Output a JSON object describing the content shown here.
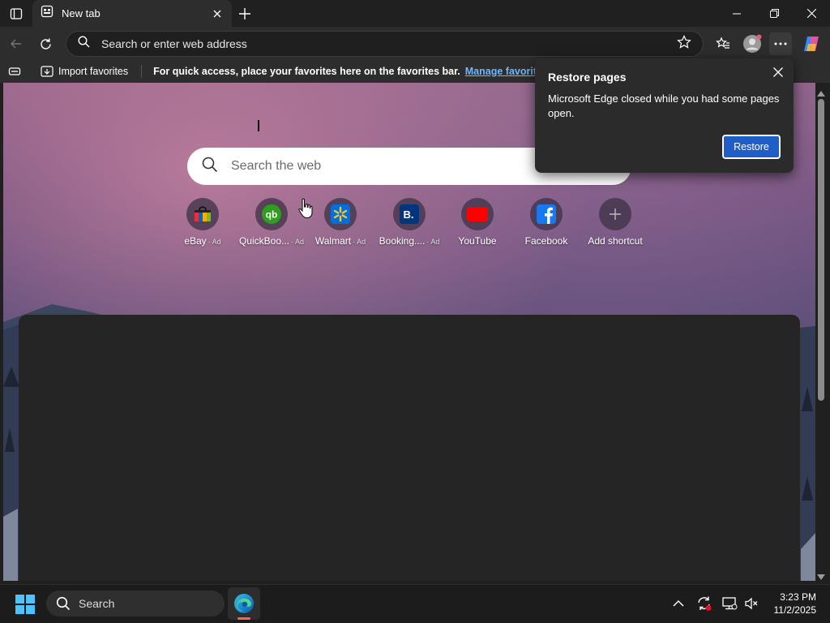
{
  "browser": {
    "tab_title": "New tab",
    "address_placeholder": "Search or enter web address"
  },
  "favorites_bar": {
    "import_label": "Import favorites",
    "message": "For quick access, place your favorites here on the favorites bar.",
    "manage_link": "Manage favorites now"
  },
  "newtab": {
    "search_placeholder": "Search the web",
    "shortcuts": [
      {
        "label": "eBay",
        "ad": "· Ad",
        "icon": "ebay-bag-icon"
      },
      {
        "label": "QuickBoo...",
        "ad": "· Ad",
        "icon": "quickbooks-icon"
      },
      {
        "label": "Walmart",
        "ad": "· Ad",
        "icon": "walmart-spark-icon"
      },
      {
        "label": "Booking....",
        "ad": "· Ad",
        "icon": "booking-icon"
      },
      {
        "label": "YouTube",
        "ad": "",
        "icon": "youtube-icon"
      },
      {
        "label": "Facebook",
        "ad": "",
        "icon": "facebook-icon"
      },
      {
        "label": "Add shortcut",
        "ad": "",
        "icon": "plus-icon"
      }
    ]
  },
  "restore_popup": {
    "title": "Restore pages",
    "body": "Microsoft Edge closed while you had some pages open.",
    "button": "Restore"
  },
  "taskbar": {
    "search_label": "Search",
    "time": "3:23 PM",
    "date": "11/2/2025"
  },
  "colors": {
    "accent": "#1f5ec9",
    "link": "#6cb8ff",
    "edge_indicator": "#f06a4b"
  }
}
